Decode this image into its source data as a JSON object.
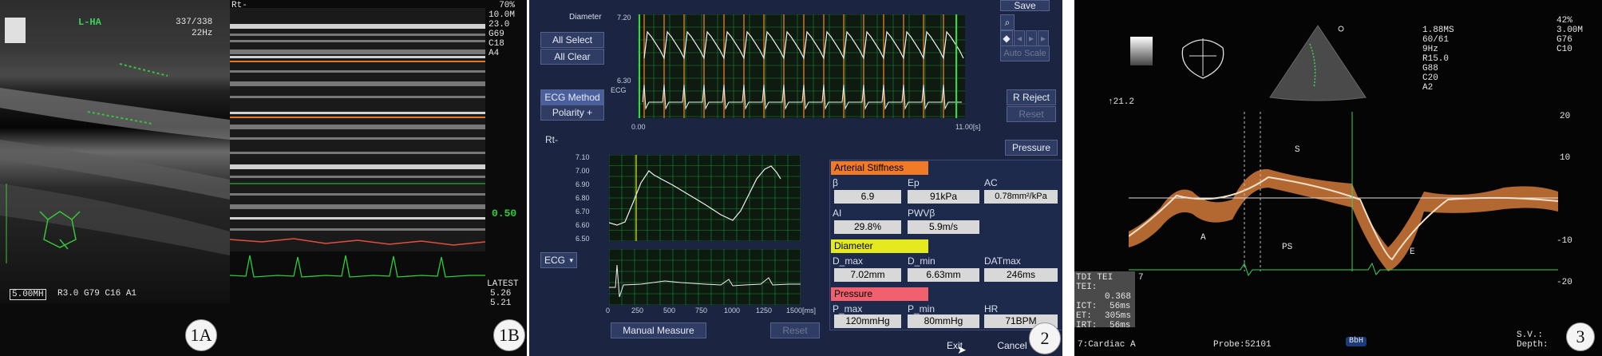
{
  "panel1": {
    "title": "L-HA",
    "frame": "337/338",
    "rate": "22Hz",
    "probe": "5.00MH",
    "params": "R3.0 G79 C16 A1",
    "badge": "1A",
    "colors": {
      "trace": "#39c43a",
      "label": "#3ad35a"
    }
  },
  "panel1b": {
    "rt": "Rt-",
    "settings": [
      "70%",
      "10.0M",
      "23.0",
      "G69",
      "C18",
      "A4"
    ],
    "scale": "0.50",
    "latest": "LATEST",
    "v1": "5.26",
    "v2": "5.21",
    "badge": "1B",
    "colors": {
      "diameter_line": "#e0503c",
      "ecg": "#2ccf3a"
    }
  },
  "panel2": {
    "diameter_label": "Diameter",
    "d_top": "7.20",
    "d_bottom": "6.30",
    "ecg_small": "ECG",
    "t_start": "0.00",
    "t_end": "11.00[s]",
    "save": "Save",
    "all_select": "All Select",
    "all_clear": "All Clear",
    "ecg_method": "ECG Method",
    "polarity": "Polarity +",
    "auto_scale": "Auto Scale",
    "r_reject": "R Reject",
    "reset_top": "Reset",
    "rt": "Rt-",
    "pressure_btn": "Pressure",
    "y_ticks": [
      "7.10",
      "7.00",
      "6.90",
      "6.80",
      "6.70",
      "6.60",
      "6.50"
    ],
    "ecg_select": "ECG",
    "x_ticks": [
      "0",
      "250",
      "500",
      "750",
      "1000",
      "1250",
      "1500[ms]"
    ],
    "manual_measure": "Manual Measure",
    "reset_bottom": "Reset",
    "exit": "Exit",
    "cancel": "Cancel",
    "badge": "2",
    "arterial": {
      "title": "Arterial Stiffness",
      "beta_label": "β",
      "beta": "6.9",
      "ep_label": "Ep",
      "ep": "91kPa",
      "ac_label": "AC",
      "ac": "0.78mm²/kPa",
      "ai_label": "AI",
      "ai": "29.8%",
      "pwv_label": "PWVβ",
      "pwv": "5.9m/s"
    },
    "diameter": {
      "title": "Diameter",
      "dmax_label": "D_max",
      "dmax": "7.02mm",
      "dmin_label": "D_min",
      "dmin": "6.63mm",
      "dat_label": "DATmax",
      "dat": "246ms"
    },
    "pressure": {
      "title": "Pressure",
      "pmax_label": "P_max",
      "pmax": "120mmHg",
      "pmin_label": "P_min",
      "pmin": "80mmHg",
      "hr_label": "HR",
      "hr": "71BPM"
    },
    "colors": {
      "header_orange": "#f07a28",
      "header_yellow": "#e5ea1e",
      "header_pink": "#f0606e",
      "grid": "#1f8a3a"
    }
  },
  "panel3": {
    "settings": [
      "1.88MS",
      "60/61",
      "9Hz",
      "R15.0",
      "G88",
      "C20",
      "A2"
    ],
    "settings_right": [
      "42%",
      "3.00M",
      "G76",
      "C10"
    ],
    "scale": "↑21.2",
    "axis": [
      "20",
      "10",
      "-10",
      "-20"
    ],
    "s_label": "S",
    "a_label": "A",
    "ps_label": "PS",
    "e_label": "E",
    "tdi_title": "TDI TEI",
    "tei_label": "TEI:",
    "tei": "0.368",
    "ict_label": "ICT:",
    "ict": "56ms",
    "et_label": "ET:",
    "et": "305ms",
    "irt_label": "IRT:",
    "irt": "56ms",
    "seven": "7",
    "preset": "7:Cardiac A",
    "probe": "Probe:52101",
    "bbh": "BbH",
    "sv": "S.V.:",
    "depth": "Depth:",
    "badge": "3"
  }
}
